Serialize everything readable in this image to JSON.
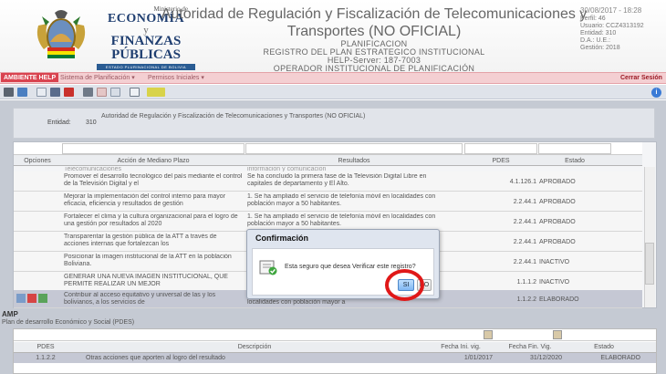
{
  "header": {
    "ministry_small": "Ministerio de",
    "ministry_line1": "ECONOMÍA",
    "ministry_y": "y",
    "ministry_line2": "FINANZAS PÚBLICAS",
    "ministry_bar": "ESTADO PLURINACIONAL DE BOLIVIA",
    "title_line1": "Autoridad de Regulación y Fiscalización de Telecomunicaciones y",
    "title_line2": "Transportes (NO OFICIAL)",
    "sub1": "PLANIFICACION",
    "sub2": "REGISTRO DEL PLAN ESTRATEGICO INSTITUCIONAL",
    "sub3": "HELP-Server: 187-7003",
    "sub4": "OPERADOR INSTITUCIONAL DE PLANIFICACIÓN",
    "datetime": "30/08/2017 - 18:28",
    "perfil": "Perfil: 46",
    "usuario": "Usuario: CCZ4313192",
    "entidad": "Entidad: 310",
    "da": "D.A.:   U.E.:",
    "gestion": "Gestión: 2018"
  },
  "menubar": {
    "ambiente": "AMBIENTE HELP",
    "menu1": "Sistema de Planificación ▾",
    "menu2": "Permisos Iniciales ▾",
    "cerrar": "Cerrar Sesión"
  },
  "entity": {
    "label": "Entidad:",
    "code": "310",
    "name": "Autoridad de Regulación y Fiscalización de Telecomunicaciones y Transportes (NO OFICIAL)"
  },
  "grid": {
    "headers": [
      "Opciones",
      "Acción de Mediano Plazo",
      "Resultados",
      "PDES",
      "Estado"
    ],
    "top_partial": {
      "accion": "Telecomunicaciones",
      "resultado": "información y comunicación"
    },
    "rows": [
      {
        "accion": "Promover el desarrollo tecnológico del país mediante el control de la Televisión Digital y el",
        "resultado": "Se ha concluido la primera fase de la Televisión Digital Libre en capitales de departamento y El Alto.",
        "pdes": "4.1.126.1",
        "estado": "APROBADO"
      },
      {
        "accion": "Mejorar la implementación del control interno para mayor eficacia, eficiencia y resultados de gestión",
        "resultado": "1. Se ha ampliado el servicio de telefonía móvil en localidades con población mayor a 50 habitantes.",
        "pdes": "2.2.44.1",
        "estado": "APROBADO"
      },
      {
        "accion": "Fortalecer el clima y la cultura organizacional para el logro de una gestión por resultados al 2020",
        "resultado": "1. Se ha ampliado el servicio de telefonía móvil en localidades con población mayor a 50 habitantes.",
        "pdes": "2.2.44.1",
        "estado": "APROBADO"
      },
      {
        "accion": "Transparentar la gestión pública de la ATT a través de  acciones internas que fortalezcan los",
        "resultado": "1.",
        "pdes": "2.2.44.1",
        "estado": "APROBADO"
      },
      {
        "accion": "Posicionar la imagen institucional de la ATT en la población Boliviana.",
        "resultado": "1.",
        "pdes": "2.2.44.1",
        "estado": "INACTIVO"
      },
      {
        "accion": "GENERAR UNA NUEVA IMAGEN INSTITUCIONAL, QUE PERMITE REALIZAR UN MEJOR",
        "resultado": "C",
        "pdes": "1.1.1.2",
        "estado": "INACTIVO"
      },
      {
        "accion": "Contribuir al acceso equitativo y universal de las y los bolivianos, a los servicios de",
        "resultado": "localidades con población mayor a",
        "pdes": "1.1.2.2",
        "estado": "ELABORADO"
      }
    ]
  },
  "amp": {
    "title": "AMP",
    "subtitle": "Plan de desarrollo Económico y Social (PDES)",
    "headers": [
      "PDES",
      "Descripción",
      "Fecha Ini. vig.",
      "Fecha Fin. Vig.",
      "Estado"
    ],
    "row": {
      "pdes": "1.1.2.2",
      "descripcion": "Otras acciones que aporten al logro del resultado",
      "ini": "1/01/2017",
      "fin": "31/12/2020",
      "estado": "ELABORADO"
    }
  },
  "dialog": {
    "title": "Confirmación",
    "message": "Esta seguro que desea Verificar este registro?",
    "yes": "SI",
    "no": "NO"
  },
  "colors": {
    "accent_red": "#e01818",
    "menubar": "#f4cfd2",
    "help_badge": "#d9434f"
  }
}
